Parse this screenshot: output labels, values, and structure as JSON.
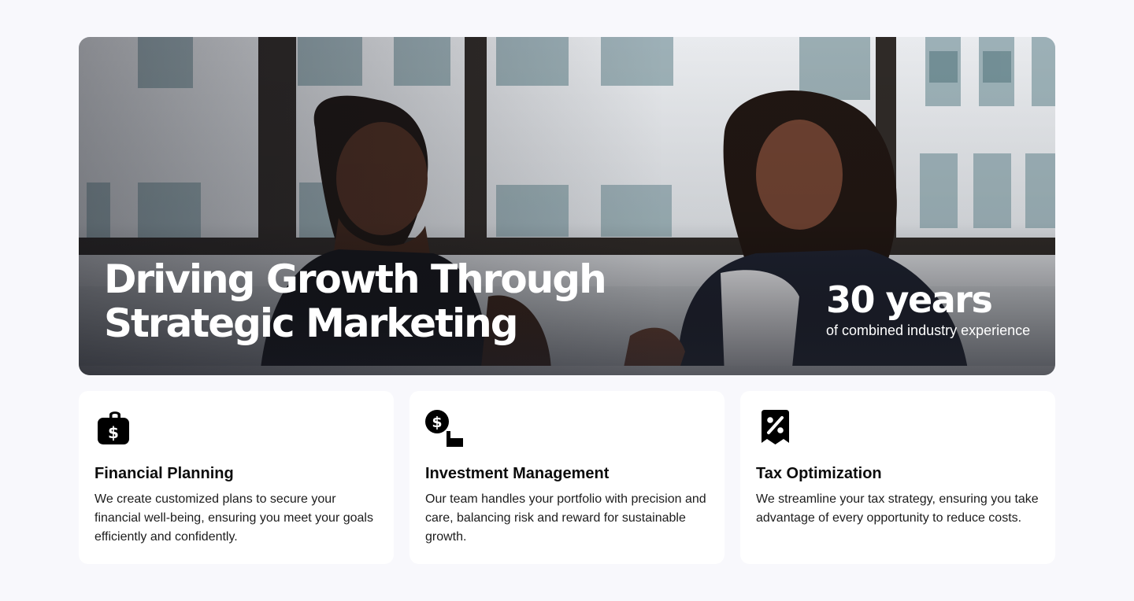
{
  "hero": {
    "title_line1": "Driving Growth Through",
    "title_line2": "Strategic Marketing",
    "stat_value": "30 years",
    "stat_label": "of combined industry experience"
  },
  "services": [
    {
      "icon": "money-bag-icon",
      "title": "Financial Planning",
      "text": "We create customized plans to secure your financial well-being, ensuring you meet your goals efficiently and confidently."
    },
    {
      "icon": "hand-coin-icon",
      "title": "Investment Management",
      "text": "Our team handles your portfolio with precision and care, balancing risk and reward for sustainable growth."
    },
    {
      "icon": "tax-receipt-icon",
      "title": "Tax Optimization",
      "text": "We streamline your tax strategy, ensuring you take advantage of every opportunity to reduce costs."
    }
  ]
}
